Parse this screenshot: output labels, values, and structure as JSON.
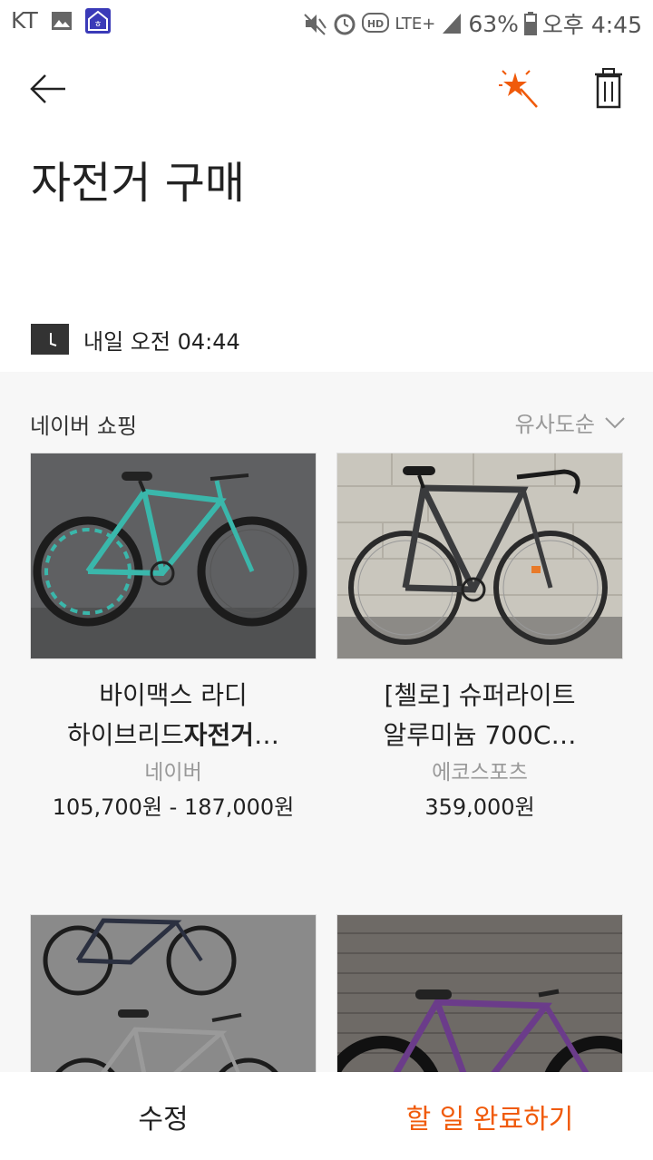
{
  "status_bar": {
    "carrier": "KT",
    "network": "LTE+",
    "battery": "63%",
    "time": "오후 4:45",
    "icons": [
      "image-icon",
      "home-app-icon",
      "mute-icon",
      "alarm-icon",
      "hd-voice-icon",
      "signal-icon",
      "battery-icon"
    ]
  },
  "header": {
    "back_icon": "back-arrow-icon",
    "magic_icon": "magic-wand-icon",
    "delete_icon": "trash-icon"
  },
  "title": "자전거 구매",
  "reminder": {
    "icon": "clock-icon",
    "text": "내일 오전 04:44"
  },
  "shopping": {
    "source": "네이버 쇼핑",
    "sort_label": "유사도순",
    "products": [
      {
        "title_line1": "바이맥스 라디",
        "title_line2_prefix": "하이브리드",
        "title_line2_bold": "자전거",
        "title_line2_suffix": "…",
        "seller": "네이버",
        "price": "105,700원 - 187,000원"
      },
      {
        "title_line1": "[첼로] 슈퍼라이트",
        "title_line2_prefix": "알루미늄 700C",
        "title_line2_bold": "",
        "title_line2_suffix": "…",
        "seller": "에코스포츠",
        "price": "359,000원"
      },
      {
        "title_line1": "",
        "seller": "",
        "price": ""
      },
      {
        "title_line1": "",
        "seller": "",
        "price": ""
      }
    ]
  },
  "bottom": {
    "edit_label": "수정",
    "done_label": "할 일 완료하기"
  },
  "colors": {
    "accent": "#f05a0a",
    "section_bg": "#f7f7f7"
  }
}
